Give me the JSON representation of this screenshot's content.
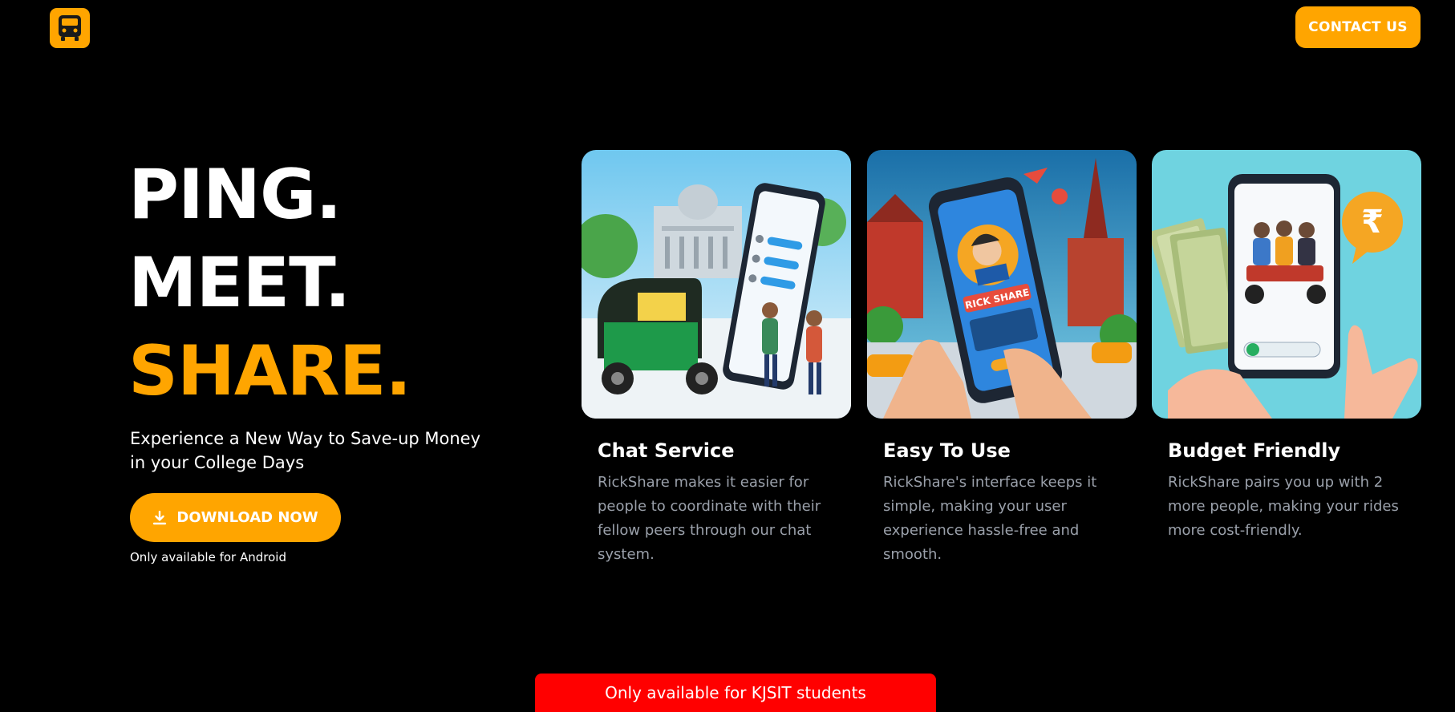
{
  "header": {
    "logo_icon": "bus-icon",
    "contact_label": "CONTACT US"
  },
  "hero": {
    "headline": [
      "PING.",
      "MEET.",
      "SHARE."
    ],
    "tagline": "Experience a New Way to Save-up Money in your College Days",
    "download_label": "DOWNLOAD NOW",
    "download_icon": "download-icon",
    "android_note": "Only available for Android"
  },
  "features": [
    {
      "title": "Chat Service",
      "description": "RickShare makes it easier for people to coordinate with their fellow peers through our chat system."
    },
    {
      "title": "Easy To Use",
      "description": "RickShare's interface keeps it simple, making your user experience hassle-free and smooth.",
      "image_text": "RICK SHARE"
    },
    {
      "title": "Budget Friendly",
      "description": "RickShare pairs you up with 2 more people, making your rides more cost-friendly.",
      "image_text": "₹"
    }
  ],
  "footer_banner": "Only available for KJSIT students",
  "colors": {
    "accent": "#ffa500",
    "background": "#000000",
    "banner": "#ff0000",
    "muted_text": "#9aa0aa"
  }
}
